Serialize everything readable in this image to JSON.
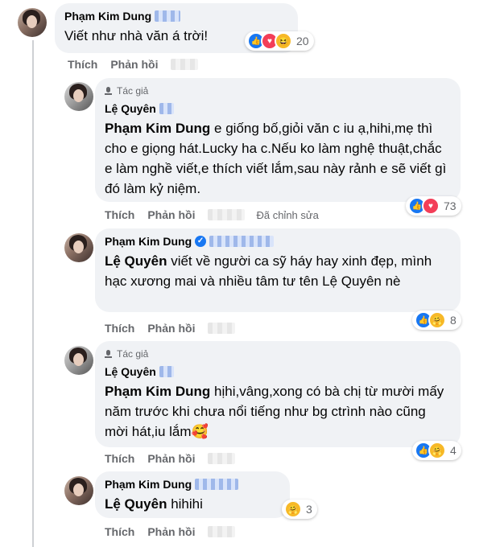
{
  "comments": [
    {
      "author": "Phạm Kim Dung",
      "text": "Viết như nhà văn á trời!",
      "actions": {
        "like": "Thích",
        "reply": "Phản hồi"
      },
      "reactions": {
        "count": "20",
        "icons": [
          "like-icon",
          "love-icon",
          "haha-icon"
        ]
      }
    },
    {
      "author_tag": "Tác giả",
      "author": "Lệ Quyên",
      "mention": "Phạm Kim Dung",
      "text": "e giống bố,giỏi văn c iu ạ,hihi,mẹ thì cho e giọng hát.Lucky ha c.Nếu ko làm nghệ thuật,chắc e làm nghề viết,e thích viết lắm,sau này rảnh e sẽ viết gì đó làm kỷ niệm.",
      "actions": {
        "like": "Thích",
        "reply": "Phản hồi",
        "edited": "Đã chỉnh sửa"
      },
      "reactions": {
        "count": "73",
        "icons": [
          "like-icon",
          "love-icon"
        ]
      }
    },
    {
      "author": "Phạm Kim Dung",
      "mention": "Lệ Quyên",
      "text": "viết về người ca sỹ háy hay xinh đẹp, mình hạc xương mai và nhiều tâm tư tên Lệ Quyên nè",
      "actions": {
        "like": "Thích",
        "reply": "Phản hồi"
      },
      "reactions": {
        "count": "8",
        "icons": [
          "like-icon",
          "care-icon"
        ]
      }
    },
    {
      "author_tag": "Tác giả",
      "author": "Lệ Quyên",
      "mention": "Phạm Kim Dung",
      "text": "hịhi,vâng,xong có bà chị từ mười mấy năm trước khi chưa nổi tiếng như bg ctrình nào cũng mời hát,iu lắm🥰",
      "actions": {
        "like": "Thích",
        "reply": "Phản hồi"
      },
      "reactions": {
        "count": "4",
        "icons": [
          "like-icon",
          "care-icon"
        ]
      }
    },
    {
      "author": "Phạm Kim Dung",
      "mention": "Lệ Quyên",
      "text": "hihihi",
      "actions": {
        "like": "Thích",
        "reply": "Phản hồi"
      },
      "reactions": {
        "count": "3",
        "icons": [
          "care-icon"
        ]
      }
    }
  ],
  "colors": {
    "bubble": "#f0f2f5",
    "like": "#1877f2",
    "love": "#f33e58",
    "muted": "#65676b"
  }
}
